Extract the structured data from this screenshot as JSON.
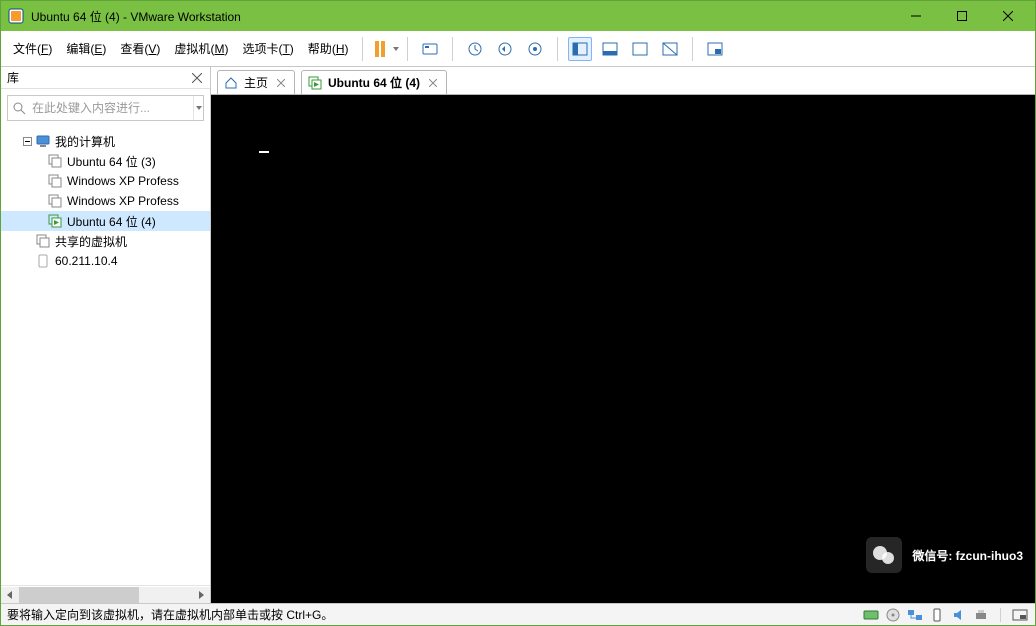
{
  "title": "Ubuntu 64 位 (4) - VMware Workstation",
  "menus": {
    "file": {
      "label": "文件",
      "key": "F"
    },
    "edit": {
      "label": "编辑",
      "key": "E"
    },
    "view": {
      "label": "查看",
      "key": "V"
    },
    "vm": {
      "label": "虚拟机",
      "key": "M"
    },
    "tabs": {
      "label": "选项卡",
      "key": "T"
    },
    "help": {
      "label": "帮助",
      "key": "H"
    }
  },
  "sidebar": {
    "header": "库",
    "search_placeholder": "在此处键入内容进行...",
    "nodes": {
      "root": "我的计算机",
      "vm1": "Ubuntu 64 位 (3)",
      "vm2": "Windows XP Profess",
      "vm3": "Windows XP Profess",
      "vm4": "Ubuntu 64 位 (4)",
      "shared": "共享的虚拟机",
      "remote": "60.211.10.4"
    }
  },
  "tabs": {
    "home": "主页",
    "active": "Ubuntu 64 位 (4)"
  },
  "status": "要将输入定向到该虚拟机，请在虚拟机内部单击或按 Ctrl+G。",
  "watermark": {
    "label": "微信号:",
    "id": "fzcun-ihuo3"
  }
}
